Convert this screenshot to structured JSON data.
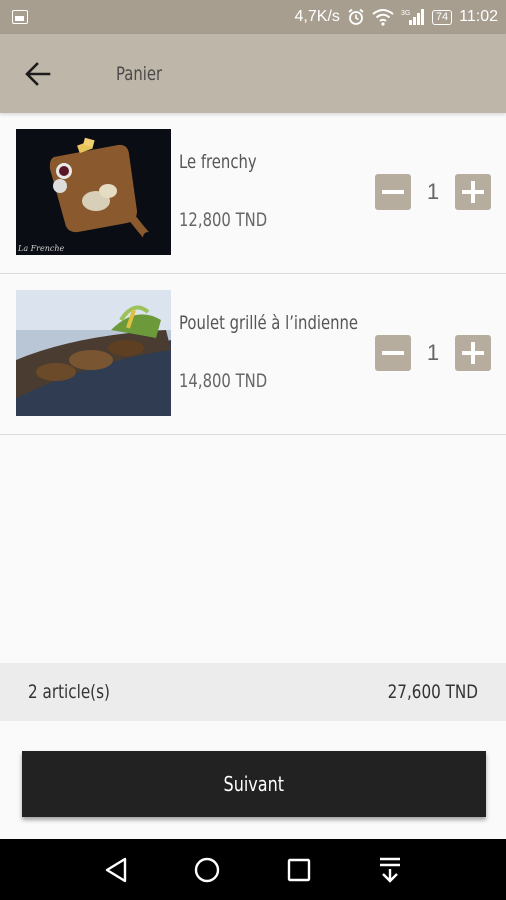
{
  "status_bar": {
    "network_speed": "4,7K/s",
    "battery": "74",
    "time": "11:02",
    "icons": [
      "app-thumbnail-icon",
      "alarm-icon",
      "wifi-icon",
      "signal-3g-icon",
      "battery-icon"
    ]
  },
  "toolbar": {
    "title": "Panier",
    "back_icon": "arrow-back-icon"
  },
  "cart": {
    "items": [
      {
        "name": "Le frenchy",
        "price": "12,800 TND",
        "quantity": "1",
        "image": "dish-photo-le-frenchy"
      },
      {
        "name": "Poulet grillé à l’indienne",
        "price": "14,800 TND",
        "quantity": "1",
        "image": "dish-photo-poulet-grille"
      }
    ]
  },
  "summary": {
    "count": "2 article(s)",
    "total": "27,600 TND"
  },
  "actions": {
    "next_label": "Suivant"
  },
  "nav_bar": {
    "icons": [
      "back-triangle-icon",
      "home-circle-icon",
      "recents-square-icon",
      "notification-pull-icon"
    ]
  },
  "colors": {
    "status_bar": "#a79e90",
    "toolbar": "#beb6a9",
    "stepper": "#b6ad9f",
    "button": "#222222",
    "summary_bg": "#ececec"
  }
}
